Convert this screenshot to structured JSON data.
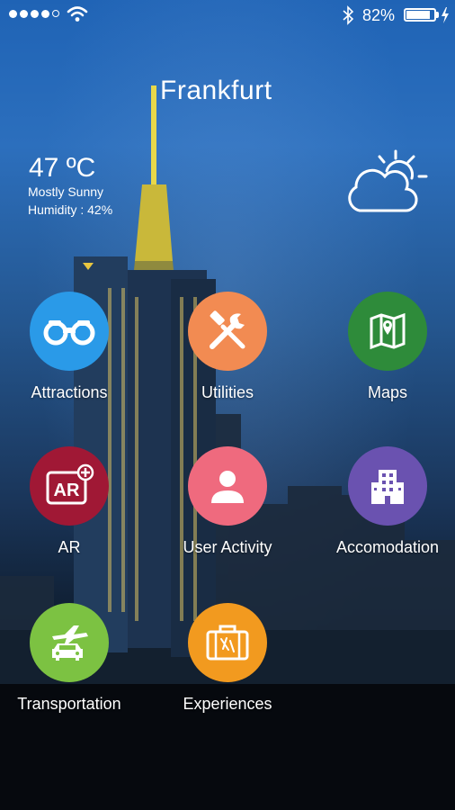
{
  "status_bar": {
    "battery": "82%"
  },
  "header": {
    "city": "Frankfurt"
  },
  "weather": {
    "temperature": "47 ºC",
    "condition": "Mostly Sunny",
    "humidity": "Humidity : 42%"
  },
  "tiles": [
    {
      "label": "Attractions",
      "color": "#2a9ae8",
      "icon": "binoculars-icon"
    },
    {
      "label": "Utilities",
      "color": "#f28b52",
      "icon": "tools-icon"
    },
    {
      "label": "Maps",
      "color": "#2e8b3a",
      "icon": "map-icon"
    },
    {
      "label": "AR",
      "color": "#a01835",
      "icon": "ar-icon"
    },
    {
      "label": "User Activity",
      "color": "#ef6a7e",
      "icon": "user-icon"
    },
    {
      "label": "Accomodation",
      "color": "#6a52b0",
      "icon": "building-icon"
    },
    {
      "label": "Transportation",
      "color": "#7cc242",
      "icon": "transport-icon"
    },
    {
      "label": "Experiences",
      "color": "#f29a1f",
      "icon": "suitcase-icon"
    }
  ]
}
